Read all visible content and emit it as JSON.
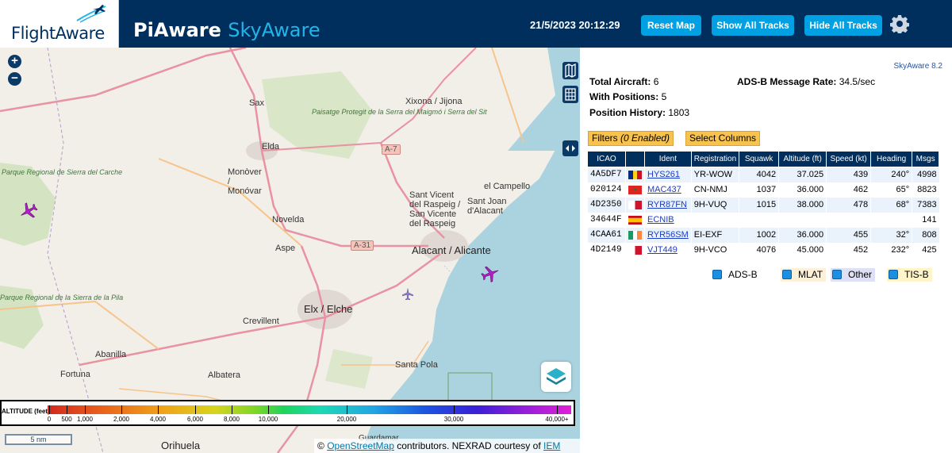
{
  "header": {
    "logo_text": "FlightAware",
    "title_main": "PiAware",
    "title_sub": "SkyAware",
    "datetime": "21/5/2023 20:12:29",
    "reset_map_label": "Reset Map",
    "show_tracks_label": "Show All Tracks",
    "hide_tracks_label": "Hide All Tracks",
    "settings_icon": "gear-icon"
  },
  "map": {
    "labels": {
      "sax": "Sax",
      "xixona": "Xixona / Jijona",
      "paisatge": "Paisatge Protegit de la Serra del Maigmó i Serra del Sit",
      "elda": "Elda",
      "monover": "Monòver / Monóvar",
      "a7": "A-7",
      "santvicent": "Sant Vicent del Raspeig / San Vicente del Raspeig",
      "santjoan": "Sant Joan d'Alacant",
      "elcampello": "el Campello",
      "novelda": "Novelda",
      "aspe": "Aspe",
      "a31": "A-31",
      "alicante": "Alacant / Alicante",
      "parque1": "Parque Regional de Sierra del Carche",
      "parque2": "Parque Regional de la Sierra de la Pila",
      "elche": "Elx / Elche",
      "crevillent": "Crevillent",
      "abanilla": "Abanilla",
      "fortuna": "Fortuna",
      "albatera": "Albatera",
      "santapola": "Santa Pola",
      "orihuela": "Orihuela",
      "guardamar": "Guardamar"
    },
    "zoom_in": "+",
    "zoom_out": "−",
    "scale": "5 nm",
    "altitude_legend": {
      "title": "ALTITUDE (feet)",
      "ticks": [
        "0",
        "500",
        "1,000",
        "2,000",
        "4,000",
        "6,000",
        "8,000",
        "10,000",
        "20,000",
        "30,000",
        "40,000+"
      ]
    },
    "attribution": {
      "prefix": "©",
      "osm": "OpenStreetMap",
      "middle": "contributors. NEXRAD courtesy of",
      "iem": "IEM"
    },
    "colors": {
      "sea": "#aad3df",
      "land": "#f2efe9",
      "park": "#c8dfb0",
      "road": "#e892a2",
      "aircraft": "#b21fc9"
    }
  },
  "sidebar": {
    "version": "SkyAware 8.2",
    "total_aircraft_label": "Total Aircraft:",
    "total_aircraft": "6",
    "message_rate_label": "ADS-B Message Rate:",
    "message_rate": "34.5/sec",
    "with_positions_label": "With Positions:",
    "with_positions": "5",
    "position_history_label": "Position History:",
    "position_history": "1803",
    "filters_label": "Filters",
    "filters_enabled": "(0 Enabled)",
    "select_columns_label": "Select Columns",
    "columns": [
      "ICAO",
      "",
      "Ident",
      "Registration",
      "Squawk",
      "Altitude (ft)",
      "Speed (kt)",
      "Heading",
      "Msgs"
    ],
    "rows": [
      {
        "icao": "4A5DF7",
        "flag": "romania",
        "ident": "HYS261",
        "registration": "YR-WOW",
        "squawk": "4042",
        "altitude": "37.025",
        "speed": "439",
        "heading": "240°",
        "msgs": "4998"
      },
      {
        "icao": "020124",
        "flag": "morocco",
        "ident": "MAC437",
        "registration": "CN-NMJ",
        "squawk": "1037",
        "altitude": "36.000",
        "speed": "462",
        "heading": "65°",
        "msgs": "8823"
      },
      {
        "icao": "4D2350",
        "flag": "malta",
        "ident": "RYR87FN",
        "registration": "9H-VUQ",
        "squawk": "1015",
        "altitude": "38.000",
        "speed": "478",
        "heading": "68°",
        "msgs": "7383"
      },
      {
        "icao": "34644F",
        "flag": "spain",
        "ident": "ECNIB",
        "registration": "",
        "squawk": "",
        "altitude": "",
        "speed": "",
        "heading": "",
        "msgs": "141"
      },
      {
        "icao": "4CAA61",
        "flag": "ireland",
        "ident": "RYR56SM",
        "registration": "EI-EXF",
        "squawk": "1002",
        "altitude": "36.000",
        "speed": "455",
        "heading": "32°",
        "msgs": "808"
      },
      {
        "icao": "4D2149",
        "flag": "malta",
        "ident": "VJT449",
        "registration": "9H-VCO",
        "squawk": "4076",
        "altitude": "45.000",
        "speed": "452",
        "heading": "232°",
        "msgs": "425"
      }
    ],
    "source_legend": [
      {
        "label": "ADS-B",
        "bg": "#ffffff"
      },
      {
        "label": "MLAT",
        "bg": "#fdf0d8"
      },
      {
        "label": "Other",
        "bg": "#dfe0f5"
      },
      {
        "label": "TIS-B",
        "bg": "#fff5c8"
      }
    ]
  }
}
